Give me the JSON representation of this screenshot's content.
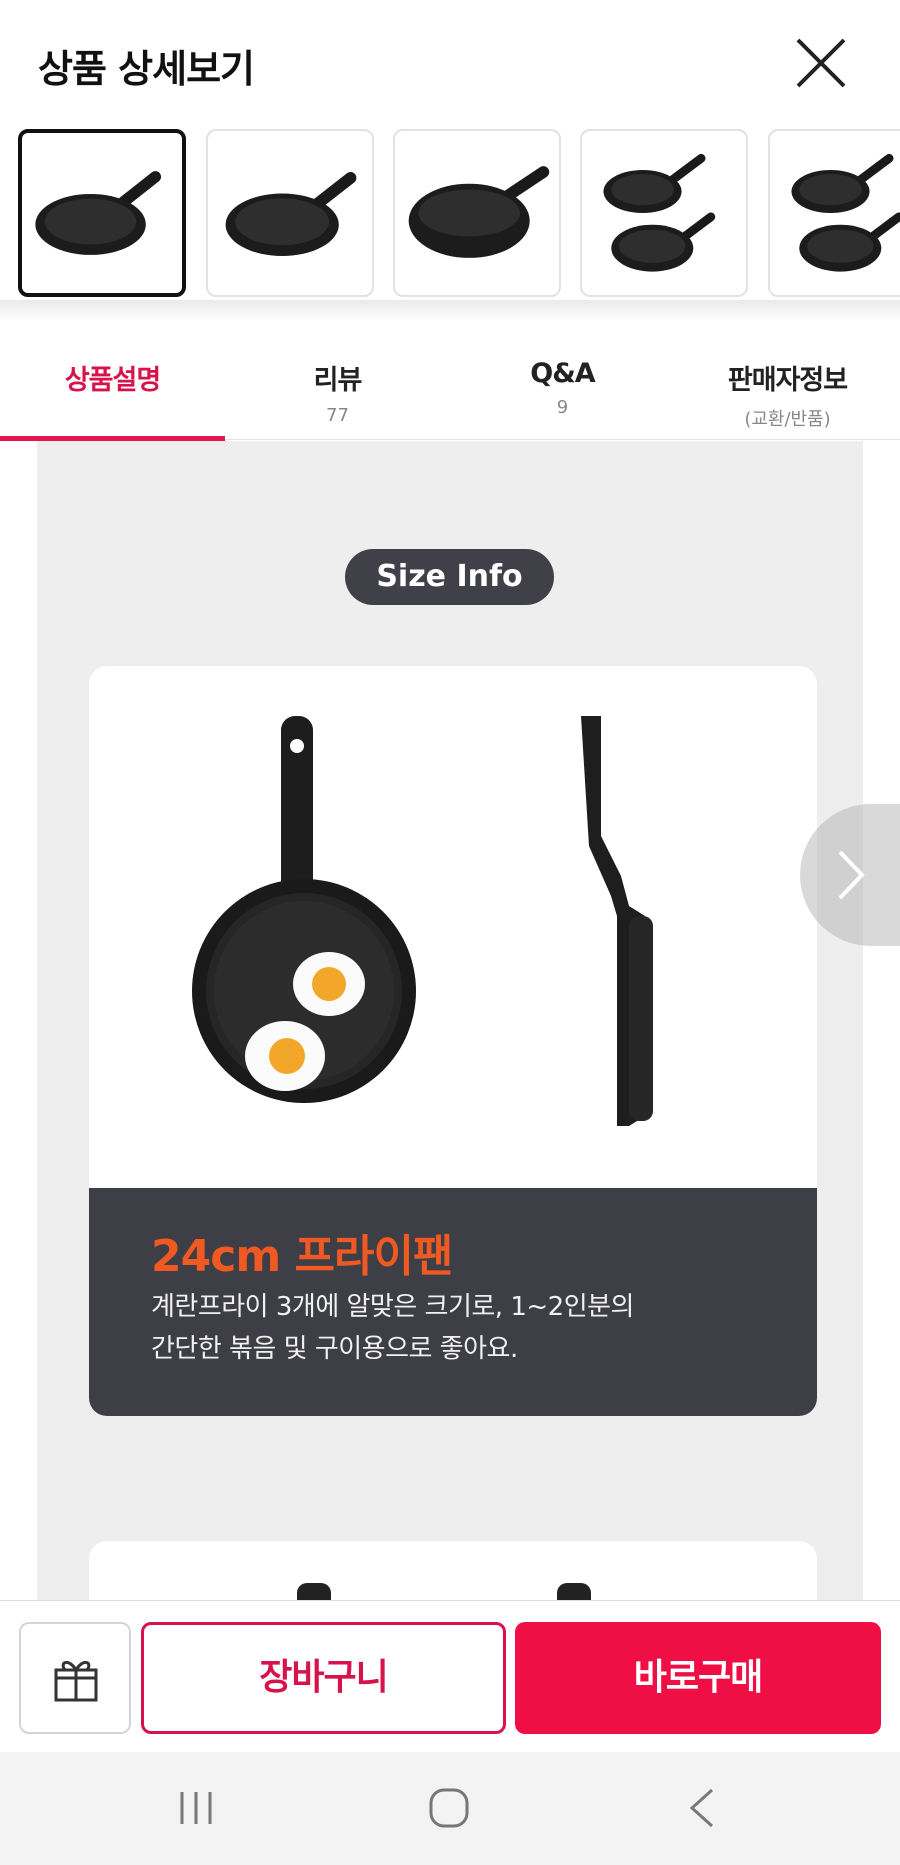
{
  "header": {
    "title": "상품 상세보기",
    "close_icon": "close-icon"
  },
  "thumbnails": [
    {
      "name": "fry-pan-angled",
      "selected": true
    },
    {
      "name": "fry-pan-angled-2",
      "selected": false
    },
    {
      "name": "fry-pan-deep",
      "selected": false
    },
    {
      "name": "fry-pan-set-two",
      "selected": false
    },
    {
      "name": "fry-pan-set-two-2",
      "selected": false
    }
  ],
  "tabs": [
    {
      "label": "상품설명",
      "sub": "",
      "active": true
    },
    {
      "label": "리뷰",
      "sub": "77",
      "active": false
    },
    {
      "label": "Q&A",
      "sub": "9",
      "active": false
    },
    {
      "label": "판매자정보",
      "sub": "(교환/반품)",
      "active": false
    }
  ],
  "content": {
    "pill": "Size Info",
    "card": {
      "title": "24cm 프라이팬",
      "desc_line1": "계란프라이 3개에 알맞은 크기로, 1~2인분의",
      "desc_line2": "간단한 볶음 및 구이용으로 좋아요."
    }
  },
  "bottom_bar": {
    "gift_icon": "gift-icon",
    "cart_label": "장바구니",
    "buy_label": "바로구매"
  },
  "colors": {
    "accent": "#d6134a",
    "buy": "#f00f45",
    "card_title": "#f05a22",
    "card_dark": "#3e3e46"
  }
}
